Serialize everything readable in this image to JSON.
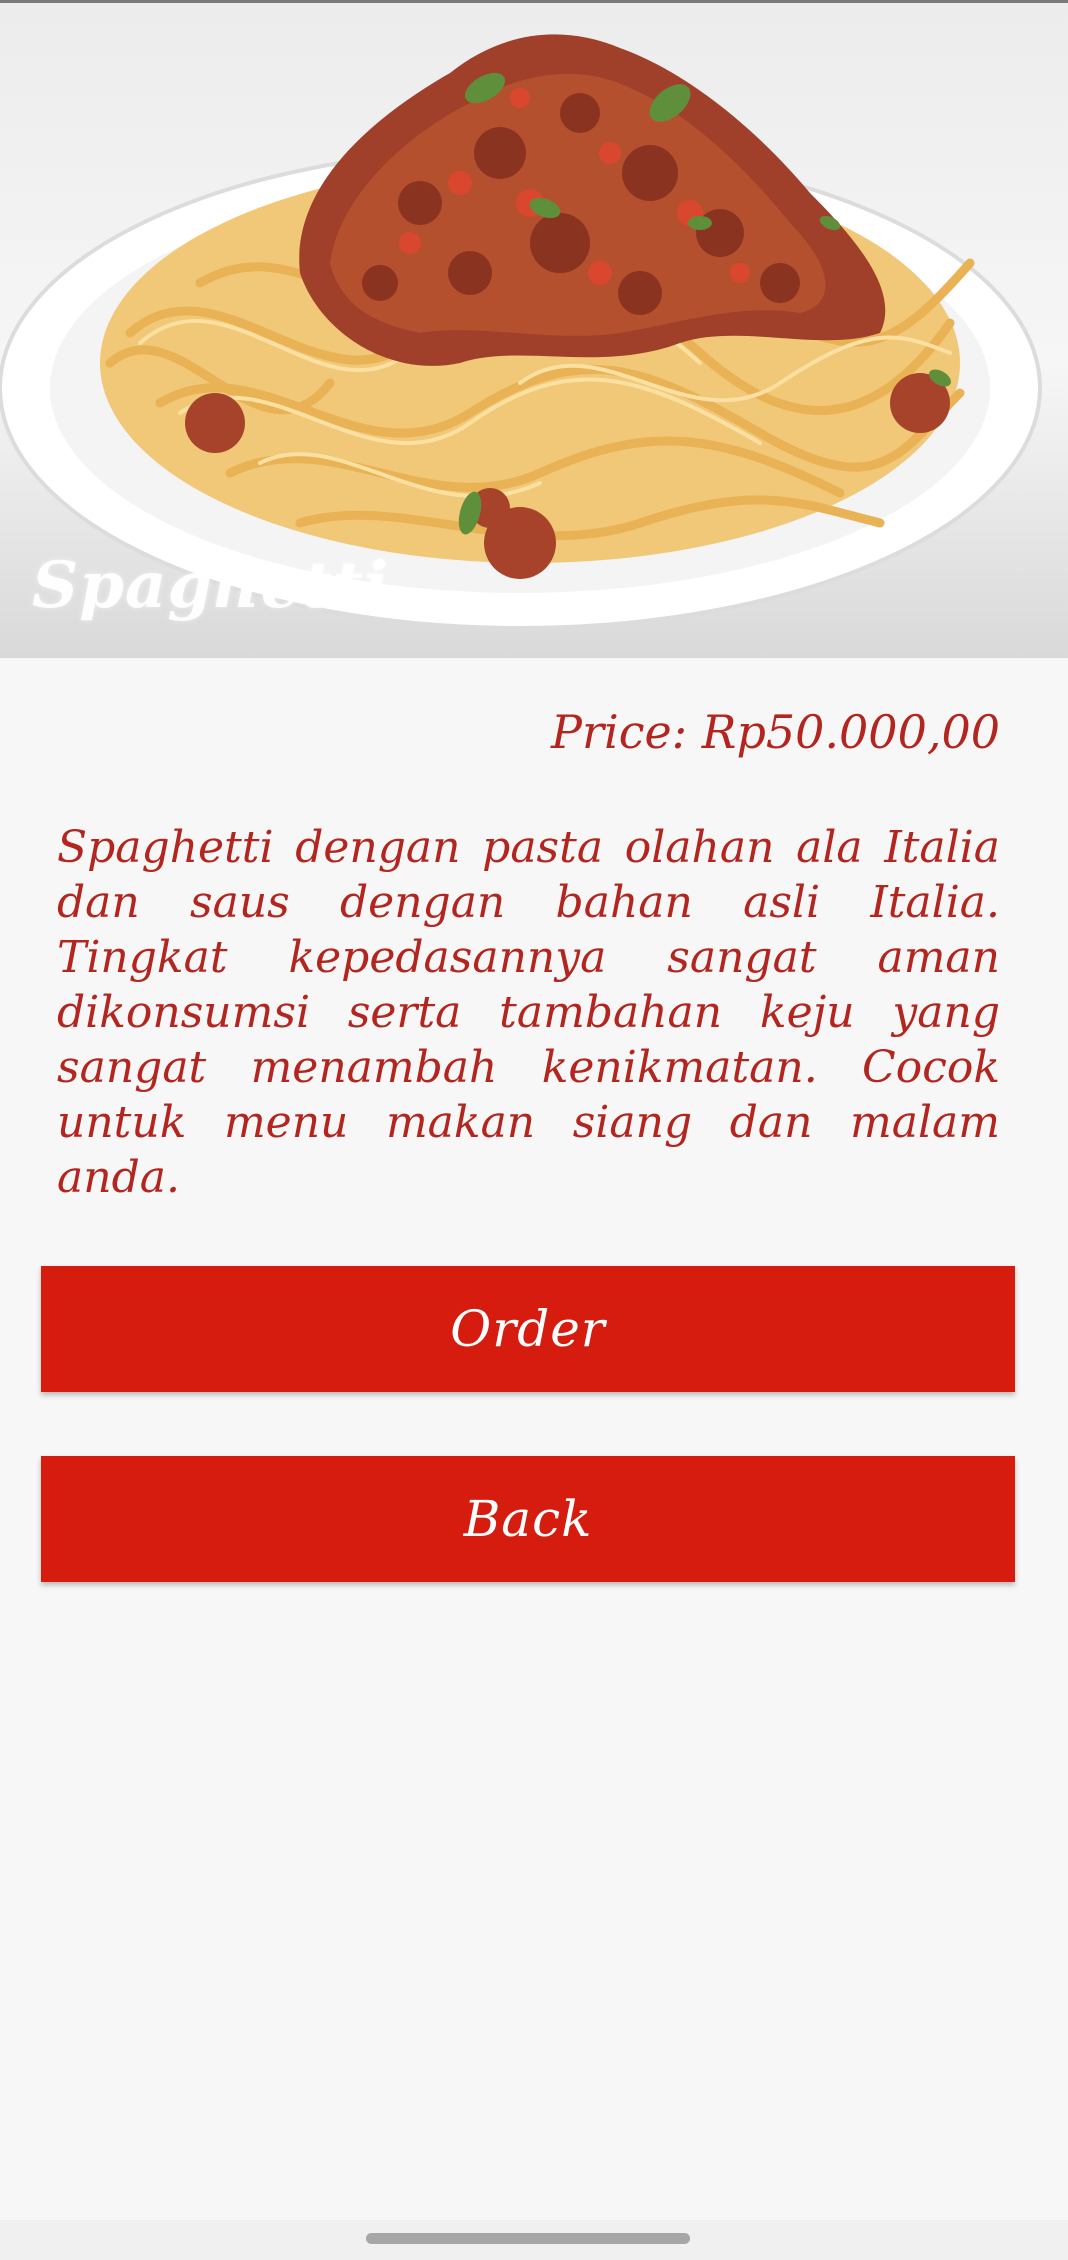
{
  "hero": {
    "title": "Spaghetti",
    "image_icon": "spaghetti-plate-photo"
  },
  "price_label": "Price: Rp50.000,00",
  "description": "Spaghetti dengan pasta olahan ala Italia dan saus dengan bahan asli Italia. Tingkat kepedasannya sangat aman dikonsumsi serta tambahan keju yang sangat menambah kenikmatan. Cocok untuk menu makan siang dan malam anda.",
  "buttons": {
    "order_label": "Order",
    "back_label": "Back"
  },
  "colors": {
    "accent_text": "#b3251f",
    "button_bg": "#d61c0f",
    "button_text": "#ffffff",
    "background": "#f7f7f7"
  }
}
